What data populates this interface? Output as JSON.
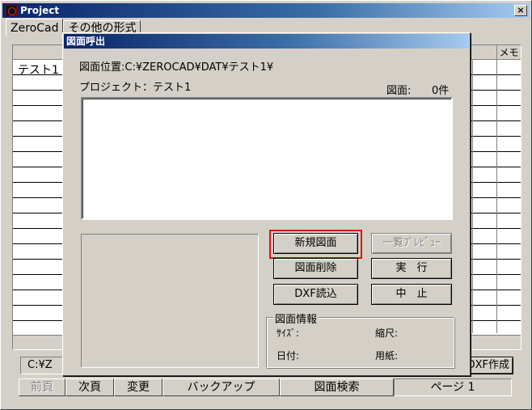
{
  "window": {
    "title": "Project",
    "close_symbol": "×"
  },
  "tabs": [
    {
      "label": "ZeroCad"
    },
    {
      "label": "その他の形式"
    }
  ],
  "grid": {
    "memo_header": "メモ",
    "first_row": "テスト1"
  },
  "footer": {
    "path_value": "C:¥Z",
    "dxf_make_label": "DXF作成",
    "buttons": {
      "prev": "前頁",
      "next": "次頁",
      "change": "変更",
      "backup": "バックアップ",
      "search": "図面検索"
    },
    "page_label": "ページ 1"
  },
  "dialog": {
    "title": "図面呼出",
    "location_label": "図面位置:C:¥ZEROCAD¥DAT¥テスト1¥",
    "project_label": "プロジェクト：テスト1",
    "count_label": "図面:",
    "count_value": "0件",
    "buttons": {
      "new_drawing": "新規図面",
      "list_preview": "一覧ﾌﾟﾚﾋﾞｭｰ",
      "delete_drawing": "図面削除",
      "execute": "実　行",
      "dxf_import": "DXF読込",
      "cancel": "中　止"
    },
    "info": {
      "legend": "図面情報",
      "size_label": "ｻｲｽﾞ:",
      "scale_label": "縮尺:",
      "date_label": "日付:",
      "paper_label": "用紙:"
    }
  },
  "colors": {
    "titlebar_start": "#0a246a",
    "titlebar_end": "#a6caf0",
    "face": "#d4d0c8",
    "highlight_box": "#e01010"
  }
}
